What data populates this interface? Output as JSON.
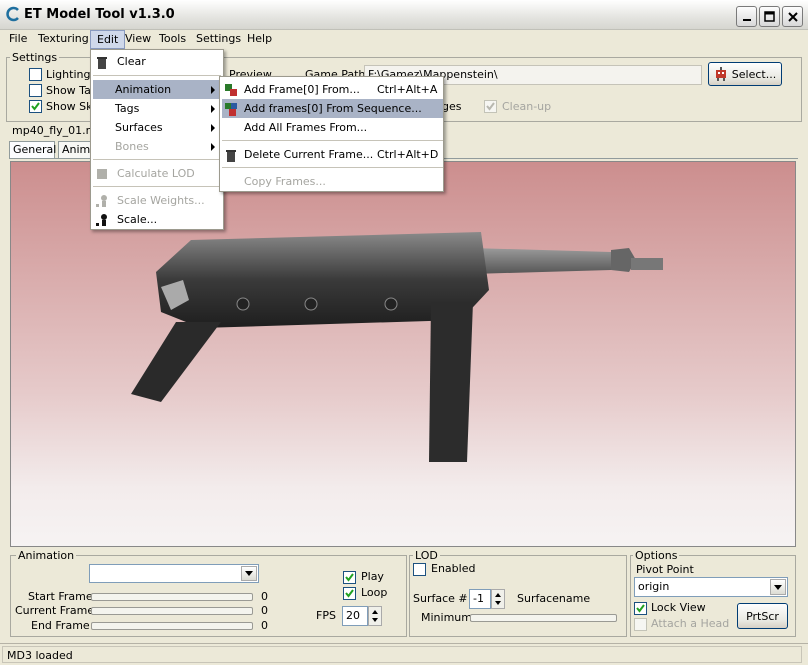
{
  "window": {
    "title": "ET Model Tool v1.3.0"
  },
  "menubar": {
    "file": "File",
    "texturing": "Texturing",
    "edit": "Edit",
    "view": "View",
    "tools": "Tools",
    "settings": "Settings",
    "help": "Help"
  },
  "settings": {
    "group_label": "Settings",
    "lighting": "Lighting",
    "show_tags": "Show Ta",
    "show_skins": "Show Sk",
    "preview": "Preview",
    "game_path_label": "Game Path",
    "game_path_value": "F:\\Gamez\\Mappenstein\\",
    "select_button": "Select...",
    "images": "ges",
    "cleanup": "Clean-up"
  },
  "file_label": "mp40_fly_01.md",
  "tabs": {
    "general": "General",
    "animation": "Anima"
  },
  "edit_menu": {
    "clear": "Clear",
    "animation": "Animation",
    "tags": "Tags",
    "surfaces": "Surfaces",
    "bones": "Bones",
    "calculate_lod": "Calculate LOD",
    "scale_weights": "Scale Weights...",
    "scale": "Scale..."
  },
  "animation_submenu": {
    "add_frame_from": "Add Frame[0] From...",
    "add_frame_from_shortcut": "Ctrl+Alt+A",
    "add_frames_seq": "Add frames[0] From Sequence...",
    "add_all_frames": "Add All Frames From...",
    "delete_frame": "Delete Current Frame...",
    "delete_frame_shortcut": "Ctrl+Alt+D",
    "copy_frames": "Copy Frames..."
  },
  "animation_panel": {
    "group_label": "Animation",
    "start_frame": "Start Frame",
    "current_frame": "Current Frame",
    "end_frame": "End Frame",
    "start_value": "0",
    "current_value": "0",
    "end_value": "0",
    "play": "Play",
    "loop": "Loop",
    "fps_label": "FPS",
    "fps_value": "20"
  },
  "lod_panel": {
    "group_label": "LOD",
    "enabled": "Enabled",
    "surface_label": "Surface #",
    "surface_value": "-1",
    "surfacename": "Surfacename",
    "minimum": "Minimum"
  },
  "options_panel": {
    "group_label": "Options",
    "pivot_label": "Pivot Point",
    "pivot_value": "origin",
    "lock_view": "Lock View",
    "attach_head": "Attach a Head",
    "prtscr": "PrtScr"
  },
  "status": {
    "text": "MD3 loaded"
  }
}
